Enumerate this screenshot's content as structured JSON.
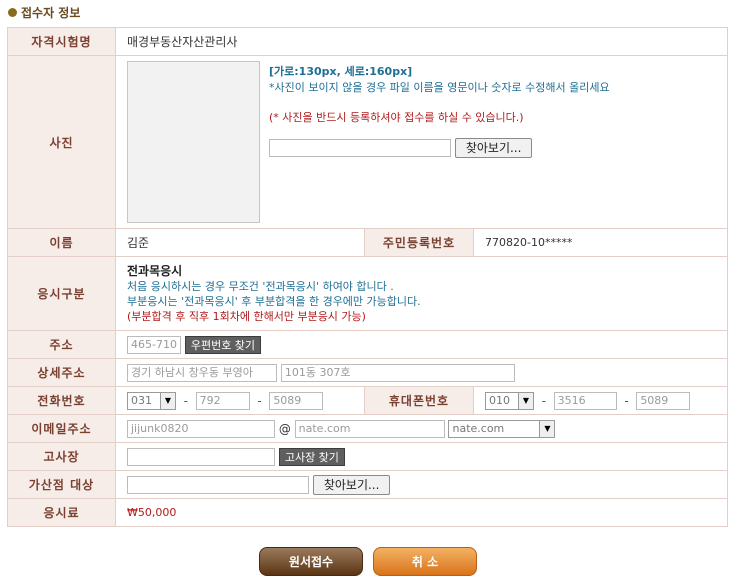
{
  "section": {
    "title": "접수자 정보"
  },
  "rows": {
    "exam_name": {
      "label": "자격시험명",
      "value": "매경부동산자산관리사"
    },
    "photo": {
      "label": "사진",
      "size_hint": "[가로:130px, 세로:160px]",
      "note": "*사진이 보이지 않을 경우 파일 이름을 영문이나 숫자로 수정해서 올리세요",
      "required": "(* 사진을 반드시 등록하셔야 접수를 하실 수 있습니다.)",
      "browse_label": "찾아보기..."
    },
    "name": {
      "label": "이름",
      "value": "김준"
    },
    "rrn": {
      "label": "주민등록번호",
      "value": "770820-10*****"
    },
    "exam_type": {
      "label": "응시구분",
      "value": "전과목응시",
      "line1": "처음 응시하시는 경우 무조건 '전과목응시' 하여야 합니다 .",
      "line2": "부분응시는 '전과목응시' 후 부분합격을 한 경우에만 가능합니다.",
      "line3": "(부분합격 후 직후 1회차에 한해서만 부분응시 가능)"
    },
    "address": {
      "label": "주소",
      "zip": "465-710",
      "zip_button": "우편번호 찾기"
    },
    "detail_address": {
      "label": "상세주소",
      "addr1": "경기 하남시 창우동 부영아",
      "addr2": "101동 307호"
    },
    "phone": {
      "label": "전화번호",
      "area": "031",
      "mid": "792",
      "last": "5089"
    },
    "mobile": {
      "label": "휴대폰번호",
      "carrier": "010",
      "mid": "3516",
      "last": "5089"
    },
    "email": {
      "label": "이메일주소",
      "id": "jijunk0820",
      "at": "@",
      "domain": "nate.com",
      "domain_select": "nate.com"
    },
    "exam_site": {
      "label": "고사장",
      "button": "고사장 찾기"
    },
    "bonus": {
      "label": "가산점 대상",
      "browse_label": "찾아보기..."
    },
    "fee": {
      "label": "응시료",
      "value": "₩50,000"
    }
  },
  "buttons": {
    "submit": "원서접수",
    "cancel": "취 소"
  },
  "colors": {
    "label_bg": "#f6ece8",
    "label_text": "#7a4030",
    "border": "#e2cfc7",
    "submit": "#6b4423",
    "cancel": "#e8892c"
  }
}
